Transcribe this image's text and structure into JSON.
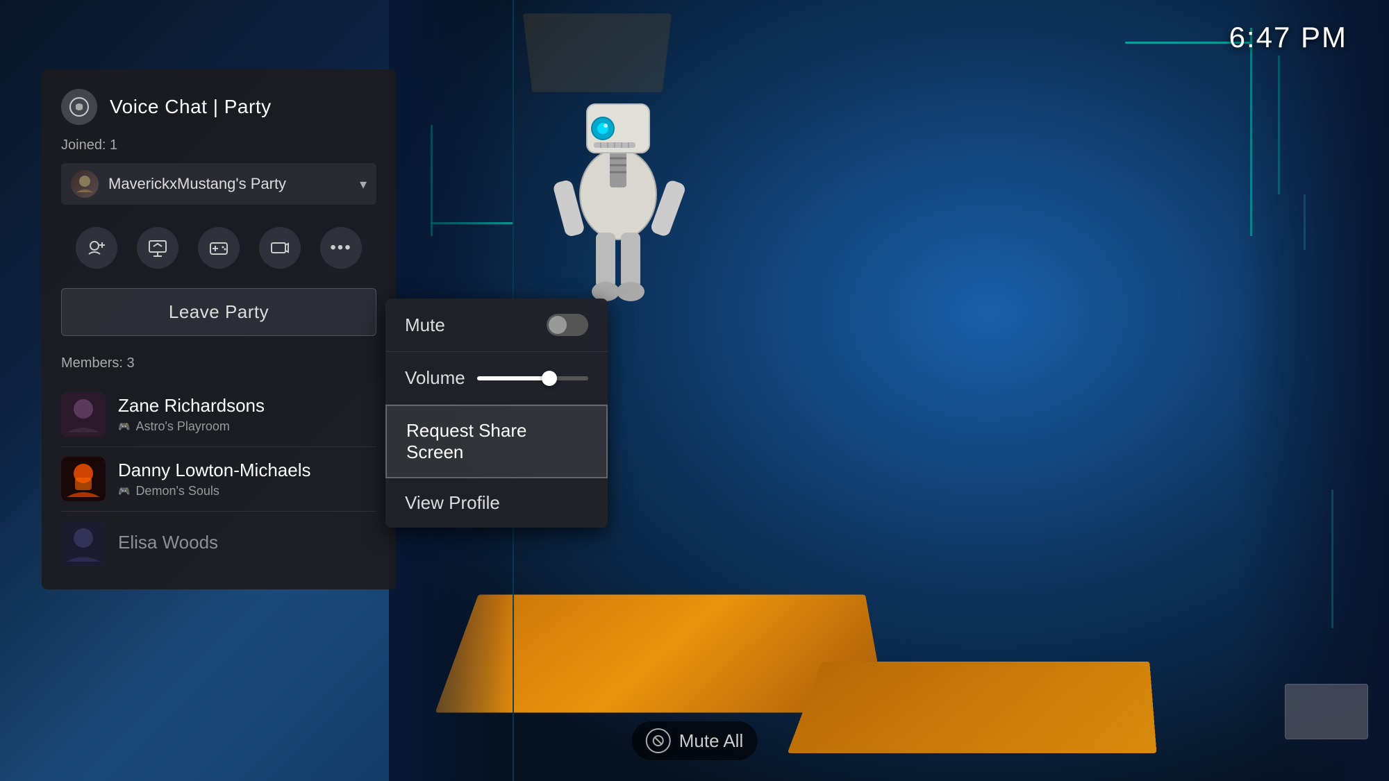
{
  "time": "6:47 PM",
  "background": {
    "description": "PlayStation game background with robot character"
  },
  "panel": {
    "title": "Voice Chat | Party",
    "joined_label": "Joined: 1",
    "party_name": "MaverickxMustang's Party",
    "members_label": "Members: 3",
    "leave_party": "Leave Party"
  },
  "action_buttons": [
    {
      "id": "add-player",
      "icon": "👤+",
      "label": "Add Player"
    },
    {
      "id": "screen-share",
      "icon": "🖥",
      "label": "Screen Share"
    },
    {
      "id": "game-share",
      "icon": "🎮",
      "label": "Game Share"
    },
    {
      "id": "camera",
      "icon": "📷",
      "label": "Camera"
    },
    {
      "id": "more",
      "icon": "···",
      "label": "More"
    }
  ],
  "members": [
    {
      "name": "Zane Richardsons",
      "game": "Astro's Playroom",
      "avatar_color": "zane"
    },
    {
      "name": "Danny Lowton-Michaels",
      "game": "Demon's Souls",
      "avatar_color": "danny"
    },
    {
      "name": "Elisa Woods",
      "game": "",
      "avatar_color": "elisa"
    }
  ],
  "context_menu": {
    "mute_label": "Mute",
    "mute_enabled": false,
    "volume_label": "Volume",
    "volume_value": 65,
    "request_share_screen": "Request Share Screen",
    "view_profile": "View Profile"
  },
  "bottom_bar": {
    "mute_all_label": "Mute All"
  }
}
